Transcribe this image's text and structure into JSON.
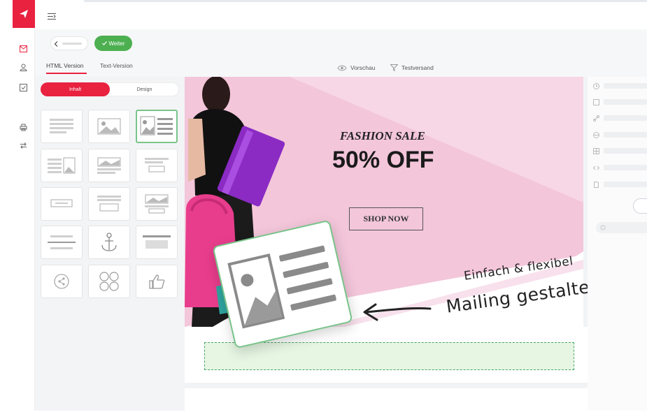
{
  "toolbar": {
    "back_label": "",
    "next_label": "Weiter"
  },
  "tabs": {
    "html": "HTML Version",
    "text": "Text-Version"
  },
  "actions": {
    "preview": "Vorschau",
    "test_send": "Testversand"
  },
  "panel": {
    "segment_content": "Inhalt",
    "segment_design": "Design"
  },
  "hero": {
    "sale_title": "FASHION SALE",
    "discount": "50% OFF",
    "cta": "SHOP NOW"
  },
  "overlay": {
    "line1": "Einfach & flexibel",
    "line2": "Mailing gestalten"
  },
  "colors": {
    "brand": "#e8223f",
    "success": "#4caf50",
    "hero_pink": "#f3c6da",
    "drop_zone": "#e6f6e3"
  }
}
